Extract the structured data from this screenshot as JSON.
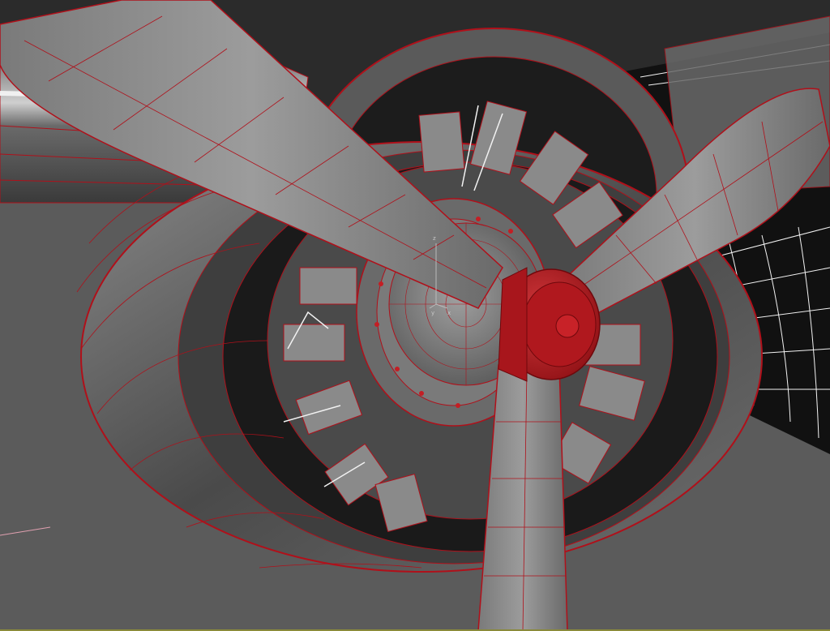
{
  "viewport": {
    "background": "#2a2a2a",
    "floor_color": "#5a5a5a",
    "mesh_shade_dark": "#3c3c3c",
    "mesh_shade_light": "#9a9a9a",
    "wire_color": "#b0101a",
    "selection_color": "#c41e24",
    "white_wire_color": "#f2f2f2",
    "bottom_border_color": "#8a8a3a"
  },
  "gizmo": {
    "z_label": "z",
    "y_label": "y",
    "x_label": "x"
  },
  "model_parts": [
    "left-wing",
    "right-wing",
    "engine-cowling-back",
    "engine-cowling-front",
    "radial-engine",
    "cylinder-heads",
    "propeller-blade-upper-left",
    "propeller-blade-upper-right",
    "propeller-blade-lower",
    "propeller-spinner",
    "propeller-hub-selected"
  ],
  "icons": {
    "transform_gizmo": "transform-gizmo-icon",
    "selected_object": "selected-hub-icon"
  }
}
